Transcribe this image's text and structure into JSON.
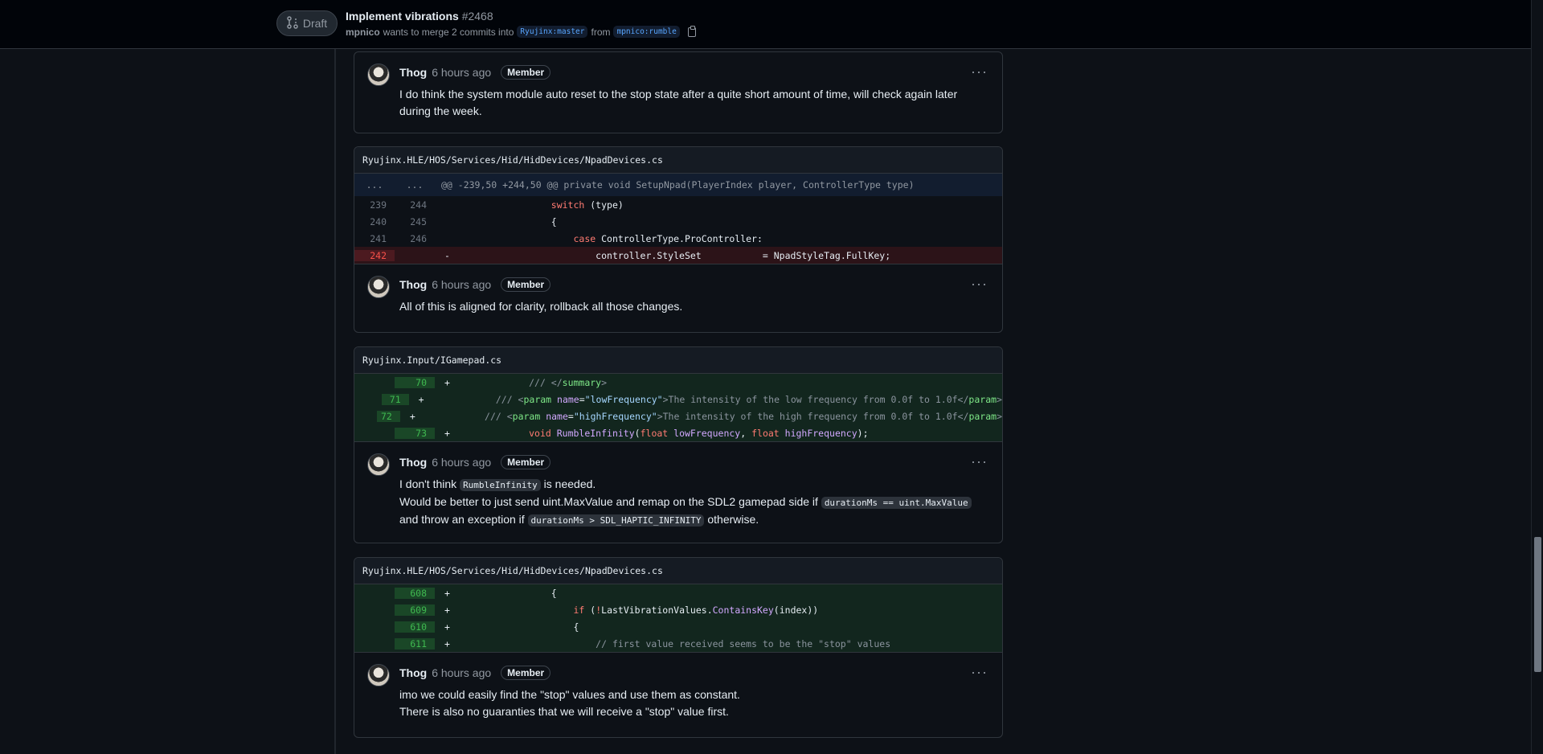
{
  "header": {
    "draft_label": "Draft",
    "title": "Implement vibrations",
    "number": "#2468",
    "author": "mpnico",
    "merge_text": "wants to merge 2 commits into",
    "base_branch": "Ryujinx:master",
    "from_text": "from",
    "head_branch": "mpnico:rumble"
  },
  "comments": {
    "c1": {
      "author": "Thog",
      "time": "6 hours ago",
      "badge": "Member",
      "line1": "I do think the system module auto reset to the stop state after a quite short amount of time, will check again later",
      "line2": "during the week."
    },
    "c2": {
      "author": "Thog",
      "time": "6 hours ago",
      "badge": "Member",
      "line1": "All of this is aligned for clarity, rollback all those changes."
    },
    "c3": {
      "author": "Thog",
      "time": "6 hours ago",
      "badge": "Member",
      "p1_a": "I don't think ",
      "p1_code": "RumbleInfinity",
      "p1_b": " is needed.",
      "p2_a": "Would be better to just send uint.MaxValue and remap on the SDL2 gamepad side if ",
      "p2_code": "durationMs == uint.MaxValue",
      "p3_a": "and throw an exception if ",
      "p3_code": "durationMs > SDL_HAPTIC_INFINITY",
      "p3_b": " otherwise."
    },
    "c4": {
      "author": "Thog",
      "time": "6 hours ago",
      "badge": "Member",
      "line1": "imo we could easily find the \"stop\" values and use them as constant.",
      "line2": "There is also no guaranties that we will receive a \"stop\" value first."
    }
  },
  "diffs": {
    "d1": {
      "file": "Ryujinx.HLE/HOS/Services/Hid/HidDevices/NpadDevices.cs",
      "hunk_left": "...",
      "hunk_right": "...",
      "hunk": "@@ -239,50 +244,50 @@ private void SetupNpad(PlayerIndex player, ControllerType type)",
      "rows": [
        {
          "o": "239",
          "n": "244",
          "s": ""
        },
        {
          "o": "240",
          "n": "245",
          "s": ""
        },
        {
          "o": "241",
          "n": "246",
          "s": ""
        },
        {
          "o": "242",
          "n": "",
          "s": "-"
        }
      ],
      "r0": {
        "kw": "switch",
        "rest": " (type)"
      },
      "r1": {
        "text": "{"
      },
      "r2": {
        "kw": "case",
        "rest": " ControllerType.ProController:"
      },
      "r3": {
        "left": "controller.StyleSet",
        "op": "= NpadStyleTag.FullKey;"
      }
    },
    "d2": {
      "file": "Ryujinx.Input/IGamepad.cs",
      "rows": [
        {
          "n": "70",
          "s": "+"
        },
        {
          "n": "71",
          "s": "+"
        },
        {
          "n": "72",
          "s": "+"
        },
        {
          "n": "73",
          "s": "+"
        }
      ],
      "r0": {
        "a": "/// </",
        "tag": "summary",
        "b": ">"
      },
      "r1": {
        "a": "/// <",
        "tag": "param",
        "attr": " name",
        "eq": "=",
        "str": "\"lowFrequency\"",
        "b": ">The intensity of the low frequency from 0.0f to 1.0f</",
        "tag2": "param",
        "c": ">"
      },
      "r2": {
        "a": "/// <",
        "tag": "param",
        "attr": " name",
        "eq": "=",
        "str": "\"highFrequency\"",
        "b": ">The intensity of the high frequency from 0.0f to 1.0f</",
        "tag2": "param",
        "c": ">"
      },
      "r3": {
        "kw": "void",
        "fn": " RumbleInfinity",
        "p1": "(",
        "t1": "float",
        "v1": " lowFrequency",
        "sep": ", ",
        "t2": "float",
        "v2": " highFrequency",
        "end": ");"
      }
    },
    "d3": {
      "file": "Ryujinx.HLE/HOS/Services/Hid/HidDevices/NpadDevices.cs",
      "rows": [
        {
          "n": "608",
          "s": "+"
        },
        {
          "n": "609",
          "s": "+"
        },
        {
          "n": "610",
          "s": "+"
        },
        {
          "n": "611",
          "s": "+"
        }
      ],
      "r0": {
        "text": "{"
      },
      "r1": {
        "kw": "if",
        "a": " (",
        "op": "!",
        "b": "LastVibrationValues.",
        "fn": "ContainsKey",
        "c": "(index))"
      },
      "r2": {
        "text": "{"
      },
      "r3": {
        "cm": "// first value received seems to be the \"stop\" values"
      }
    }
  }
}
